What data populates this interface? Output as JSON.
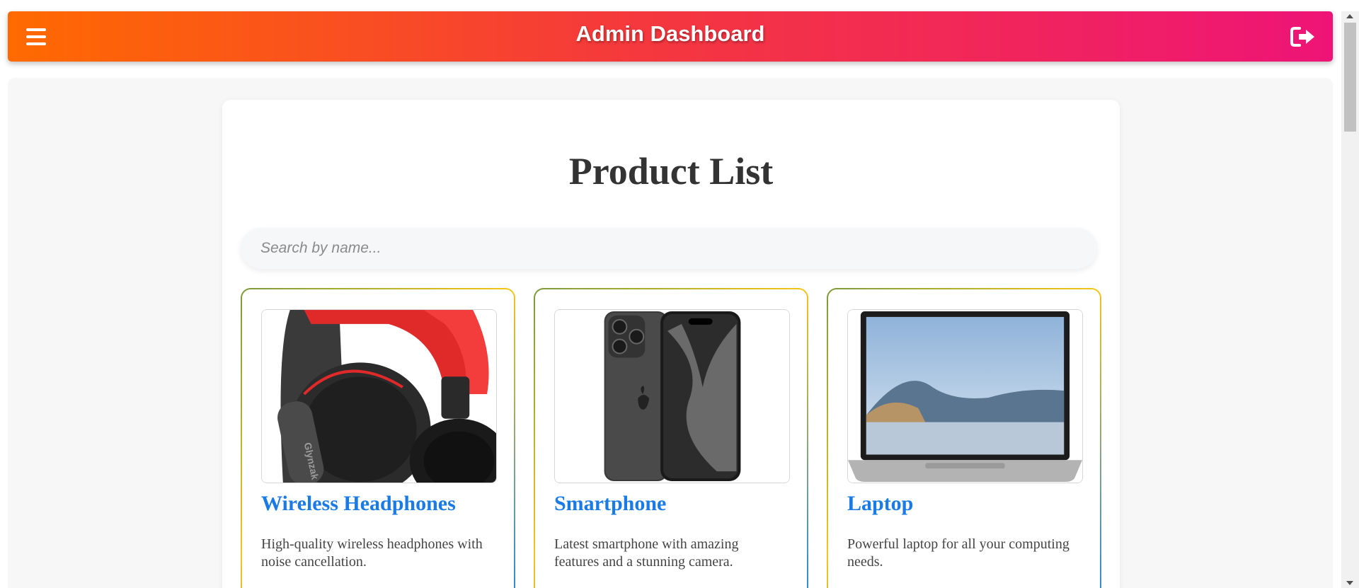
{
  "header": {
    "title": "Admin Dashboard",
    "menu_icon": "hamburger-menu-icon",
    "logout_icon": "logout-icon",
    "gradient_colors": [
      "#ff6a00",
      "#ee1477"
    ]
  },
  "main": {
    "title": "Product List",
    "search": {
      "placeholder": "Search by name...",
      "value": ""
    },
    "products": [
      {
        "name": "Wireless Headphones",
        "description": "High-quality wireless headphones with noise cancellation.",
        "image": "headphones-image",
        "brand_text": "Glynzak"
      },
      {
        "name": "Smartphone",
        "description": "Latest smartphone with amazing features and a stunning camera.",
        "image": "smartphone-image"
      },
      {
        "name": "Laptop",
        "description": "Powerful laptop for all your computing needs.",
        "image": "laptop-image"
      }
    ]
  },
  "colors": {
    "product_name": "#1a7be6",
    "title_text": "#333333"
  }
}
